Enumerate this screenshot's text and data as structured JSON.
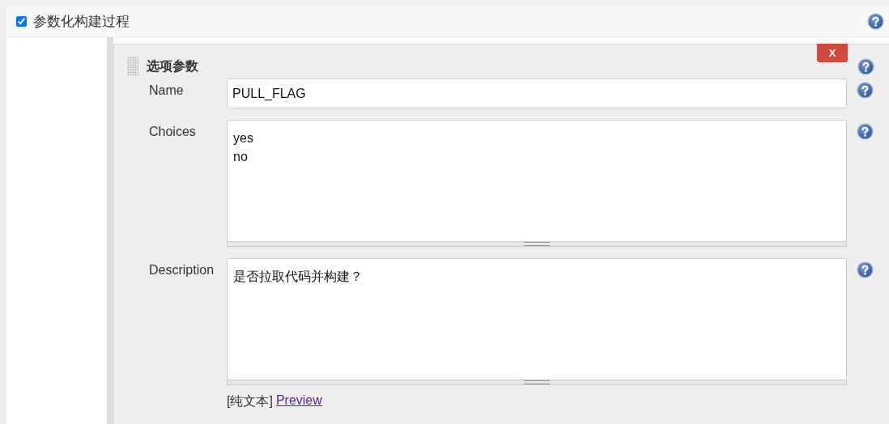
{
  "header": {
    "label": "参数化构建过程",
    "checked": true
  },
  "parameter": {
    "title": "选项参数",
    "delete_button": "X",
    "fields": [
      {
        "label": "Name",
        "kind": "input",
        "value": "PULL_FLAG"
      },
      {
        "label": "Choices",
        "kind": "textarea",
        "value": "yes\nno"
      },
      {
        "label": "Description",
        "kind": "textarea",
        "value": "是否拉取代码并构建？"
      }
    ],
    "format": {
      "mode": "[纯文本]",
      "preview_link": "Preview"
    }
  }
}
